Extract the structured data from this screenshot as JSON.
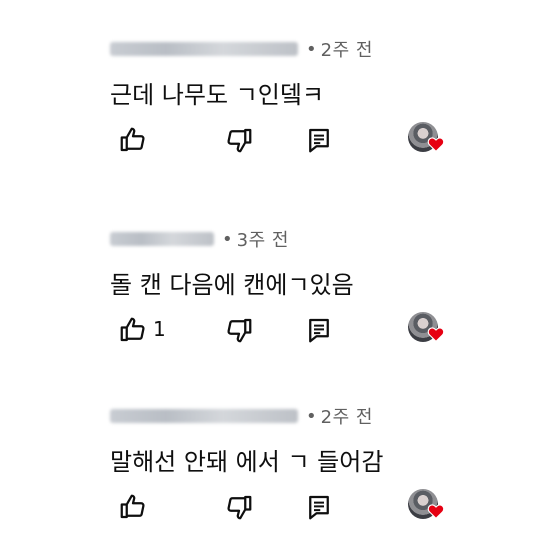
{
  "separator": "•",
  "comments": [
    {
      "time": "2주 전",
      "text": "근데 나무도 ㄱ인뎈ㅋ",
      "like_count": "",
      "icons": [
        "thumb-up-icon",
        "thumb-down-icon",
        "reply-icon",
        "creator-avatar",
        "heart-icon"
      ]
    },
    {
      "time": "3주 전",
      "text": "돌 캔 다음에 캔에ㄱ있음",
      "like_count": "1",
      "icons": [
        "thumb-up-icon",
        "thumb-down-icon",
        "reply-icon",
        "creator-avatar",
        "heart-icon"
      ]
    },
    {
      "time": "2주 전",
      "text": "말해선 안돼 에서 ㄱ 들어감",
      "like_count": "",
      "icons": [
        "thumb-up-icon",
        "thumb-down-icon",
        "reply-icon",
        "creator-avatar",
        "heart-icon"
      ]
    }
  ],
  "colors": {
    "text": "#0f0f0f",
    "meta": "#606060",
    "heart": "#e60012"
  }
}
